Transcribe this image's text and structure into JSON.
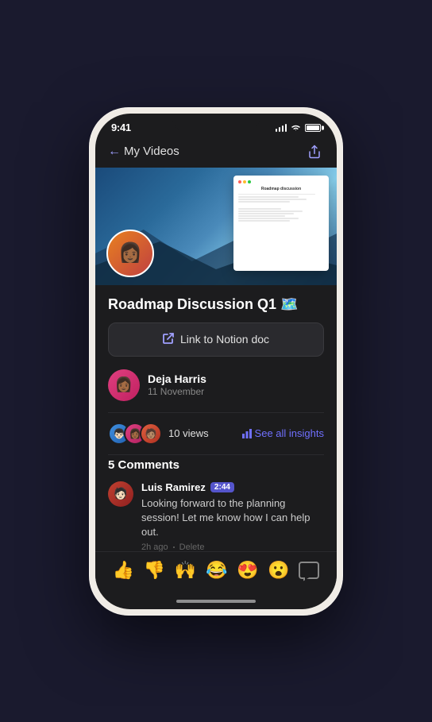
{
  "status_bar": {
    "time": "9:41"
  },
  "nav": {
    "back_label": "My Videos",
    "share_label": "Share"
  },
  "video": {
    "title": "Roadmap Discussion Q1 🗺️",
    "thumbnail_alt": "Video thumbnail with presenter"
  },
  "link_button": {
    "label": "Link to Notion doc"
  },
  "notion_doc": {
    "title": "Roadmap discussion"
  },
  "author": {
    "name": "Deja Harris",
    "date": "11 November",
    "emoji": "👩"
  },
  "views": {
    "count": "10 views",
    "insights_label": "See all insights"
  },
  "comments": {
    "header": "5 Comments",
    "items": [
      {
        "author": "Luis Ramirez",
        "time_badge": "2:44",
        "text": "Looking forward to the planning session! Let me know how I can help out.",
        "age": "2h ago",
        "delete_label": "Delete",
        "emoji": "🧑"
      }
    ]
  },
  "reactions": {
    "items": [
      "👍",
      "👎",
      "🙌",
      "😂",
      "😍",
      "😮"
    ]
  }
}
